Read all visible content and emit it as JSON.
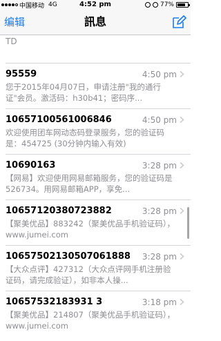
{
  "status_bar": {
    "carrier": "中国移动",
    "network": "4G",
    "time": "4:52 pm",
    "battery": "77%",
    "battery_level": 0.77
  },
  "nav": {
    "edit_label": "编辑",
    "title": "訊息",
    "compose_icon": "compose-icon"
  },
  "partial_row": {
    "text": "TD"
  },
  "messages": [
    {
      "sender": "95559",
      "time": "4:50 pm",
      "preview": "您于2015年04月07日，申请注册\"我的通行证\"会员。激活码：h30b41；密码序..."
    },
    {
      "sender": "10657100561006846",
      "time": "4:50 pm",
      "preview": "欢迎使用团车网动态码登录服务，您的验证码是：454725 (30分钟内输入有效)"
    },
    {
      "sender": "10690163",
      "time": "3:28 pm",
      "preview": "【网易】欢迎使用网易邮箱服务，您的验证码是526734。用网易邮箱APP，享免..."
    },
    {
      "sender": "10657120380723882",
      "time": "3:28 pm",
      "preview": "【聚美优品】883242（聚美优品手机验证码），www.jumei.com"
    },
    {
      "sender": "10657502130507061888",
      "time": "3:28 pm",
      "preview": "【大众点评】427312（大众点评网手机注册验证码，请完成验证），如非本人操..."
    },
    {
      "sender": "10657532183931 3",
      "time": "3:18 pm",
      "preview": "【聚美优品】214807（聚美优品手机验证码），www.jumei.com"
    }
  ]
}
